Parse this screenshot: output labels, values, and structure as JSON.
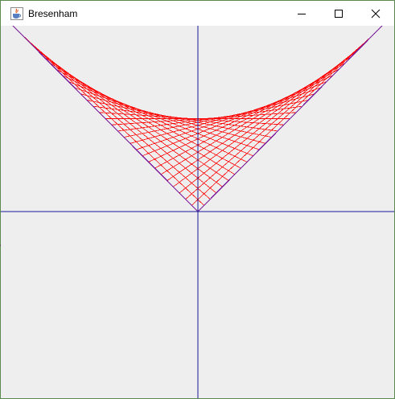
{
  "window": {
    "title": "Bresenham",
    "icon": "java-coffee-cup-icon",
    "controls": [
      "minimize-icon",
      "maximize-icon",
      "close-icon"
    ]
  },
  "colors": {
    "background": "#eeeeee",
    "axes": "#1a1a9a",
    "envelope": "#7a1a9a",
    "curves": "#ff0000"
  }
}
